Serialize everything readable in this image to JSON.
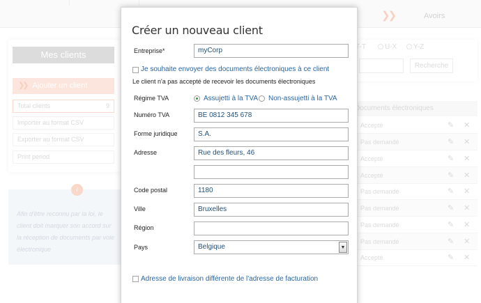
{
  "background": {
    "topbar": {
      "avoirs_label": "Avoirs"
    },
    "sidebar": {
      "title": "Mes clients",
      "add_client": "Ajouter un client",
      "items": [
        {
          "label": "Total clients",
          "count": "9"
        },
        {
          "label": "Importer au format CSV",
          "count": ""
        },
        {
          "label": "Exporter au format CSV",
          "count": ""
        },
        {
          "label": "Print period",
          "count": ""
        }
      ],
      "info_badge": "i",
      "info_text": "Afin d'être reconnu par la loi, le client doit marquer son accord sur la réception de documents par voie électronique"
    },
    "filters": {
      "options": [
        "T-T",
        "U-X",
        "Y-Z"
      ],
      "search_button": "Recherche"
    },
    "table": {
      "header": "Documents électroniques",
      "rows": [
        "Accepté",
        "Pas demandé",
        "Accepté",
        "Accepté",
        "Pas demandé",
        "Pas demandé",
        "Pas demandé",
        "Pas demandé",
        "Pas demandé",
        "Accepté"
      ]
    }
  },
  "modal": {
    "title": "Créer un nouveau client",
    "entreprise_label": "Entreprise*",
    "entreprise_value": "myCorp",
    "edoc_checkbox_label": "Je souhaite envoyer des documents électroniques à ce client",
    "edoc_note": "Le client n'a pas accepté de recevoir les documents électroniques",
    "regime_label": "Régime TVA",
    "regime_options": [
      "Assujetti à la TVA",
      "Non-assujetti à la TVA"
    ],
    "numero_tva_label": "Numéro TVA",
    "numero_tva_value": "BE 0812 345 678",
    "forme_label": "Forme juridique",
    "forme_value": "S.A.",
    "adresse_label": "Adresse",
    "adresse_value": "Rue des fleurs, 46",
    "adresse2_value": "",
    "code_postal_label": "Code postal",
    "code_postal_value": "1180",
    "ville_label": "Ville",
    "ville_value": "Bruxelles",
    "region_label": "Région",
    "region_value": "",
    "pays_label": "Pays",
    "pays_value": "Belgique",
    "livraison_checkbox_label": "Adresse de livraison différente de l'adresse de facturation"
  },
  "colors": {
    "accent": "#2866a3",
    "brand_orange": "#f7b49a",
    "radio_selected": "#2e9a36"
  },
  "icons": {
    "edit": "pencil-icon",
    "delete": "close-icon",
    "chevrons": "double-chevron-right-icon"
  }
}
